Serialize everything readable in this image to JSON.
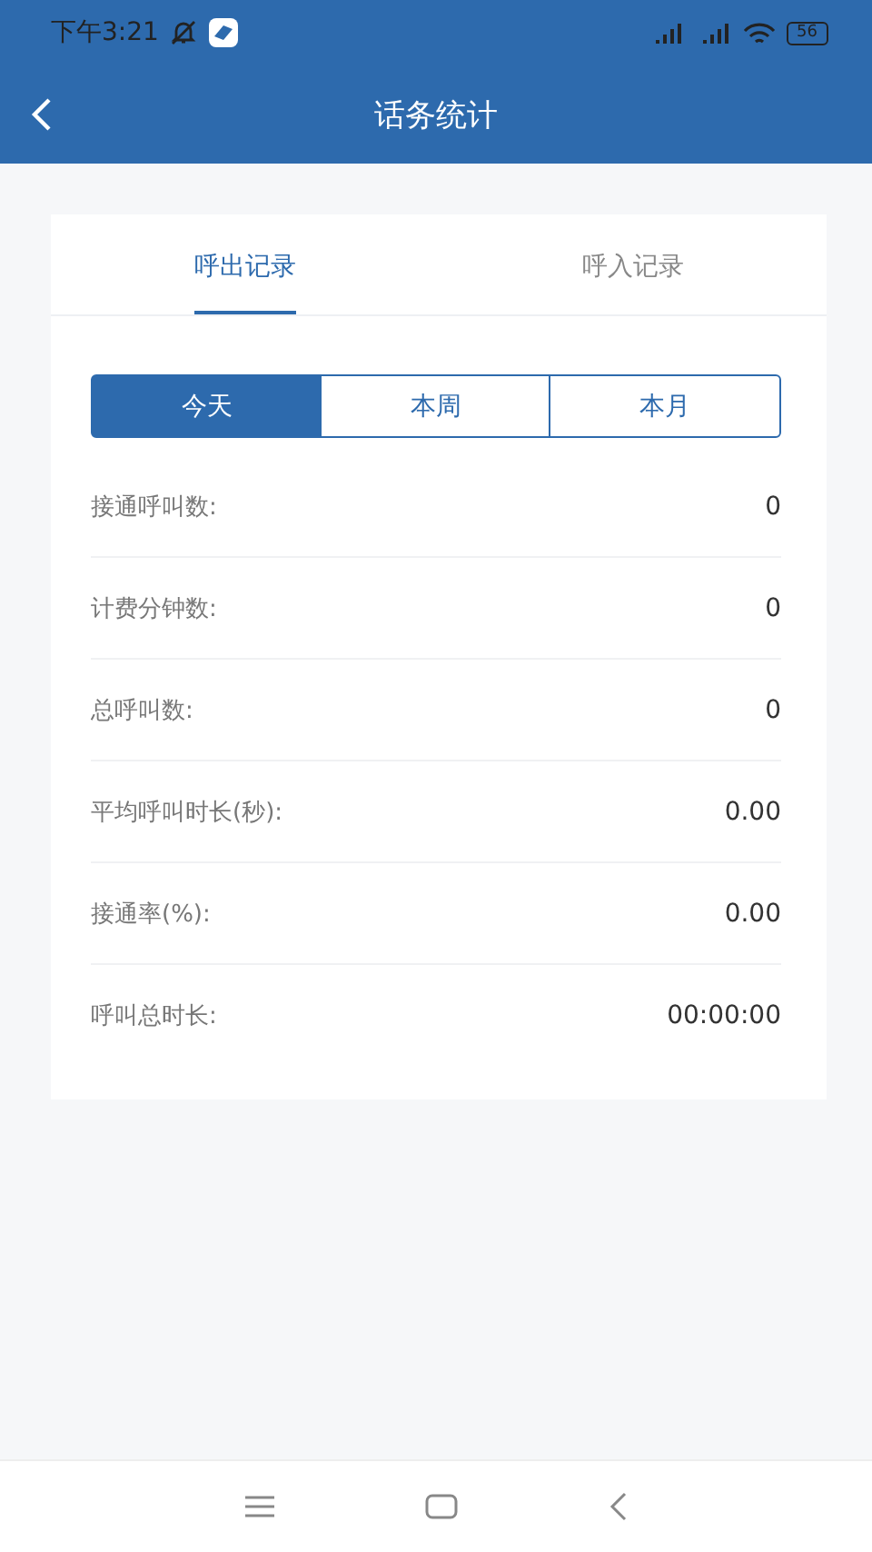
{
  "status_bar": {
    "time": "下午3:21",
    "battery": "56"
  },
  "header": {
    "title": "话务统计"
  },
  "tabs": [
    {
      "label": "呼出记录",
      "selected": true
    },
    {
      "label": "呼入记录",
      "selected": false
    }
  ],
  "periods": [
    {
      "label": "今天",
      "selected": true
    },
    {
      "label": "本周",
      "selected": false
    },
    {
      "label": "本月",
      "selected": false
    }
  ],
  "stats": [
    {
      "label": "接通呼叫数:",
      "value": "0"
    },
    {
      "label": "计费分钟数:",
      "value": "0"
    },
    {
      "label": "总呼叫数:",
      "value": "0"
    },
    {
      "label": "平均呼叫时长(秒):",
      "value": "0.00"
    },
    {
      "label": "接通率(%):",
      "value": "0.00"
    },
    {
      "label": "呼叫总时长:",
      "value": "00:00:00"
    }
  ]
}
